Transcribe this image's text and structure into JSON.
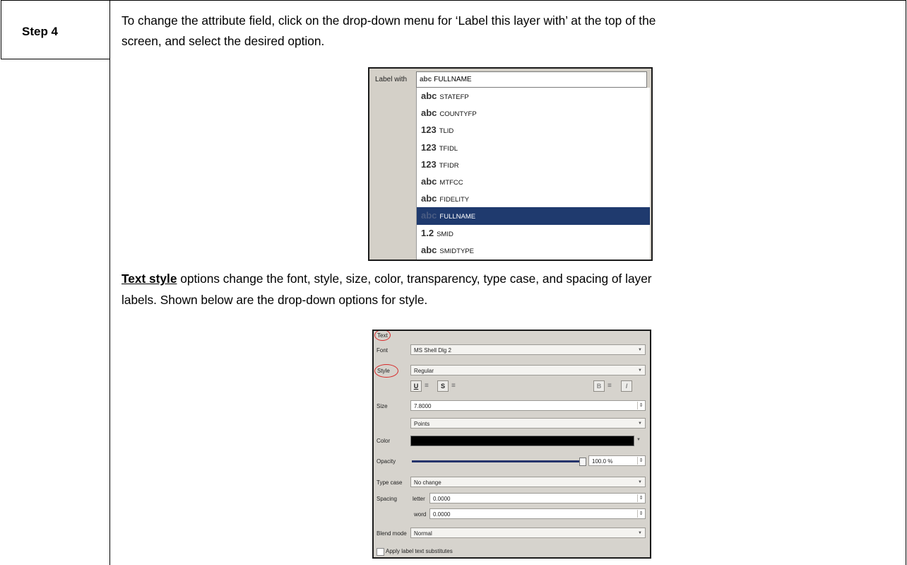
{
  "step": {
    "label": "Step 4"
  },
  "paragraphs": {
    "p1_line1": "To change the attribute field, click on the drop-down menu for ‘Label this layer with’ at the top of the",
    "p1_line2": "screen, and select the desired option.",
    "p2_link": "Text style",
    "p2_line1_rest": " options change the font, style, size, color, transparency, type case, and spacing of layer",
    "p2_line2": "labels. Shown below are the drop-down options for style."
  },
  "label_dropdown": {
    "label": "Label with",
    "current_type": "abc",
    "current_value": "FULLNAME",
    "options": [
      {
        "type": "abc",
        "name": "STATEFP"
      },
      {
        "type": "abc",
        "name": "COUNTYFP"
      },
      {
        "type": "123",
        "name": "TLID"
      },
      {
        "type": "123",
        "name": "TFIDL"
      },
      {
        "type": "123",
        "name": "TFIDR"
      },
      {
        "type": "abc",
        "name": "MTFCC"
      },
      {
        "type": "abc",
        "name": "FIDELITY"
      },
      {
        "type": "abc",
        "name": "FULLNAME",
        "selected": true
      },
      {
        "type": "1.2",
        "name": "SMID"
      },
      {
        "type": "abc",
        "name": "SMIDTYPE"
      }
    ],
    "selected_color": "#1f3a6e"
  },
  "text_panel": {
    "section": "Text",
    "font_label": "Font",
    "font_value": "MS Shell Dlg 2",
    "style_label": "Style",
    "style_value": "Regular",
    "format_buttons": [
      "U",
      "S",
      "B",
      "I"
    ],
    "size_label": "Size",
    "size_value": "7.8000",
    "size_unit": "Points",
    "color_label": "Color",
    "color_value": "#000000",
    "opacity_label": "Opacity",
    "opacity_value": "100.0 %",
    "opacity_fraction": 1.0,
    "typecase_label": "Type case",
    "typecase_value": "No change",
    "spacing_label": "Spacing",
    "letter_label": "letter",
    "letter_value": "0.0000",
    "word_label": "word",
    "word_value": "0.0000",
    "blend_label": "Blend mode",
    "blend_value": "Normal",
    "substitutes_label": "Apply label text substitutes",
    "highlight_color": "#d62b2b"
  }
}
